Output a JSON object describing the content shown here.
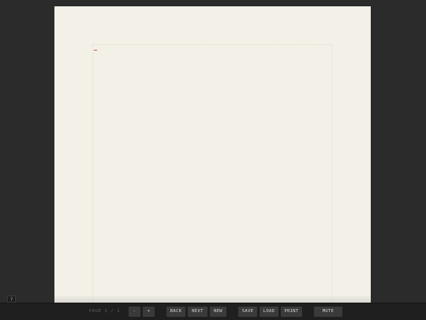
{
  "toolbar": {
    "page_label": "PAGE",
    "page_current": "1",
    "page_separator": "/",
    "page_total": "1",
    "zoom_out_label": "-",
    "zoom_in_label": "+",
    "back_label": "BACK",
    "next_label": "NEXT",
    "new_label": "NEW",
    "save_label": "SAVE",
    "load_label": "LOAD",
    "print_label": "PRINT",
    "mute_label": "MUTE"
  },
  "corner": {
    "toggle_label": "?"
  },
  "colors": {
    "background": "#2b2b2b",
    "paper": "#f3f0e8",
    "toolbar": "#1f1f1f",
    "button": "#3a3a3a",
    "cursor": "#b65a4a"
  }
}
